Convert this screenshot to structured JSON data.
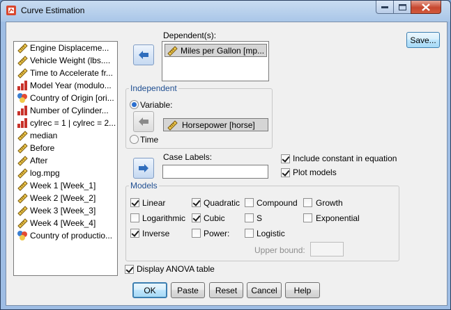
{
  "window": {
    "title": "Curve Estimation"
  },
  "variables": [
    {
      "label": "Engine Displaceme...",
      "icon": "scale-ruler-icon"
    },
    {
      "label": "Vehicle Weight (lbs....",
      "icon": "scale-ruler-icon"
    },
    {
      "label": "Time to Accelerate fr...",
      "icon": "scale-ruler-icon"
    },
    {
      "label": "Model Year (modulo...",
      "icon": "ordinal-bars-icon"
    },
    {
      "label": "Country of Origin [ori...",
      "icon": "nominal-circles-icon"
    },
    {
      "label": "Number of Cylinder...",
      "icon": "ordinal-bars-icon"
    },
    {
      "label": "cylrec = 1 | cylrec = 2...",
      "icon": "ordinal-bars-icon"
    },
    {
      "label": "median",
      "icon": "scale-ruler-icon"
    },
    {
      "label": "Before",
      "icon": "scale-ruler-icon"
    },
    {
      "label": "After",
      "icon": "scale-ruler-icon"
    },
    {
      "label": "log.mpg",
      "icon": "scale-ruler-icon"
    },
    {
      "label": "Week 1 [Week_1]",
      "icon": "scale-ruler-icon"
    },
    {
      "label": "Week 2 [Week_2]",
      "icon": "scale-ruler-icon"
    },
    {
      "label": "Week 3 [Week_3]",
      "icon": "scale-ruler-icon"
    },
    {
      "label": "Week 4 [Week_4]",
      "icon": "scale-ruler-icon"
    },
    {
      "label": "Country of productio...",
      "icon": "nominal-circles-icon"
    }
  ],
  "dependent": {
    "label": "Dependent(s):",
    "value": "Miles per Gallon [mp..."
  },
  "independent": {
    "title": "Independent",
    "variable_label": "Variable:",
    "time_label": "Time",
    "selected_option": "Variable",
    "value": "Horsepower [horse]"
  },
  "case_labels": {
    "label": "Case Labels:",
    "value": ""
  },
  "options": {
    "include_constant": {
      "label": "Include constant in equation",
      "checked": true
    },
    "plot_models": {
      "label": "Plot models",
      "checked": true
    }
  },
  "models": {
    "title": "Models",
    "items": [
      {
        "label": "Linear",
        "checked": true
      },
      {
        "label": "Quadratic",
        "checked": true
      },
      {
        "label": "Compound",
        "checked": false
      },
      {
        "label": "Growth",
        "checked": false
      },
      {
        "label": "Logarithmic",
        "checked": false
      },
      {
        "label": "Cubic",
        "checked": true
      },
      {
        "label": "S",
        "checked": false
      },
      {
        "label": "Exponential",
        "checked": false
      },
      {
        "label": "Inverse",
        "checked": true
      },
      {
        "label": "Power:",
        "checked": false
      },
      {
        "label": "Logistic",
        "checked": false
      }
    ],
    "upper_bound_label": "Upper bound:",
    "upper_bound_value": ""
  },
  "display_anova": {
    "label": "Display ANOVA table",
    "checked": true
  },
  "buttons": {
    "save": "Save...",
    "ok": "OK",
    "paste": "Paste",
    "reset": "Reset",
    "cancel": "Cancel",
    "help": "Help"
  },
  "colors": {
    "accent_blue": "#2b6fcf",
    "group_title": "#1f4e91",
    "close_red": "#c7472f"
  }
}
